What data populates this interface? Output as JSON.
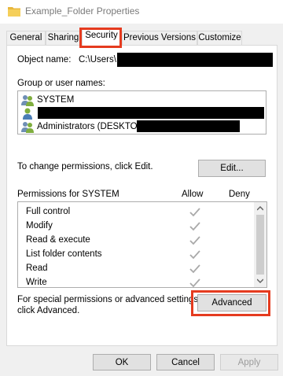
{
  "window": {
    "title": "Example_Folder Properties",
    "icon": "folder-icon"
  },
  "tabs": [
    {
      "label": "General"
    },
    {
      "label": "Sharing"
    },
    {
      "label": "Security",
      "active": true
    },
    {
      "label": "Previous Versions"
    },
    {
      "label": "Customize"
    }
  ],
  "security": {
    "object_name_label": "Object name:",
    "object_name_value": "C:\\Users\\",
    "group_label": "Group or user names:",
    "users": [
      {
        "name": "SYSTEM",
        "icon": "users-group-icon",
        "selected": true
      },
      {
        "name": "",
        "icon": "user-icon",
        "redacted": true
      },
      {
        "name": "Administrators (DESKTOP",
        "icon": "users-group-icon",
        "redacted_tail": true
      }
    ],
    "change_permissions_text": "To change permissions, click Edit.",
    "edit_button": "Edit...",
    "permissions_for_label": "Permissions for SYSTEM",
    "allow_header": "Allow",
    "deny_header": "Deny",
    "permissions": [
      {
        "name": "Full control",
        "allow": true,
        "deny": false
      },
      {
        "name": "Modify",
        "allow": true,
        "deny": false
      },
      {
        "name": "Read & execute",
        "allow": true,
        "deny": false
      },
      {
        "name": "List folder contents",
        "allow": true,
        "deny": false
      },
      {
        "name": "Read",
        "allow": true,
        "deny": false
      },
      {
        "name": "Write",
        "allow": true,
        "deny": false
      }
    ],
    "advanced_text_line1": "For special permissions or advanced settings,",
    "advanced_text_line2": "click Advanced.",
    "advanced_button": "Advanced"
  },
  "footer": {
    "ok_button": "OK",
    "cancel_button": "Cancel",
    "apply_button": "Apply"
  },
  "colors": {
    "highlight": "#e53b1f",
    "check_disabled": "#a9a9a9"
  }
}
